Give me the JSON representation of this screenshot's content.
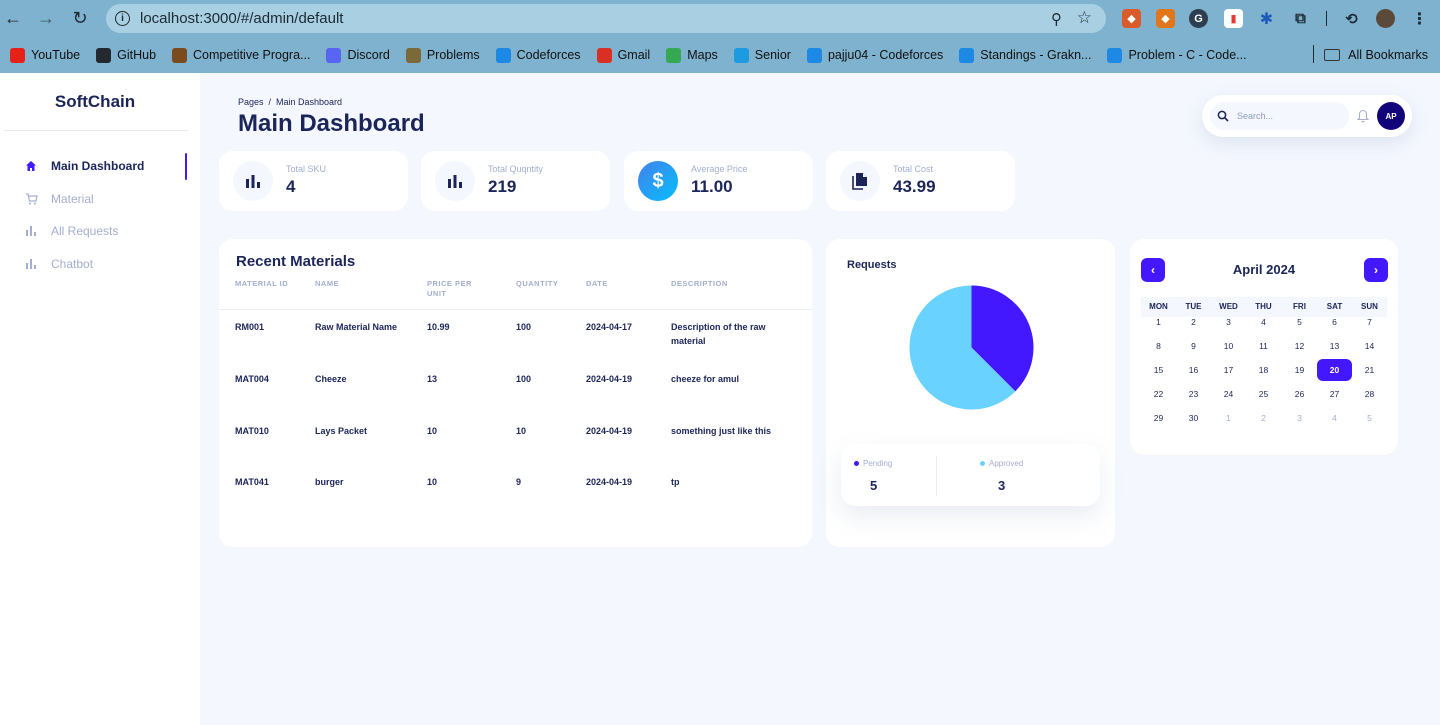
{
  "browser": {
    "url": "localhost:3000/#/admin/default",
    "bookmarks": [
      {
        "label": "YouTube",
        "color": "#e62117"
      },
      {
        "label": "GitHub",
        "color": "#24292f"
      },
      {
        "label": "Competitive Progra...",
        "color": "#7a4b21"
      },
      {
        "label": "Discord",
        "color": "#5865f2"
      },
      {
        "label": "Problems",
        "color": "#7a6a3a"
      },
      {
        "label": "Codeforces",
        "color": "#1e88e5"
      },
      {
        "label": "Gmail",
        "color": "#d93025"
      },
      {
        "label": "Maps",
        "color": "#34a853"
      },
      {
        "label": "Senior",
        "color": "#1e9be0"
      },
      {
        "label": "pajju04 - Codeforces",
        "color": "#1e88e5"
      },
      {
        "label": "Standings - Grakn...",
        "color": "#1e88e5"
      },
      {
        "label": "Problem - C - Code...",
        "color": "#1e88e5"
      }
    ],
    "all_bookmarks": "All Bookmarks"
  },
  "sidebar": {
    "brand": "SoftChain",
    "items": [
      {
        "label": "Main Dashboard",
        "icon": "home-icon"
      },
      {
        "label": "Material",
        "icon": "cart-icon"
      },
      {
        "label": "All Requests",
        "icon": "bar-chart-icon"
      },
      {
        "label": "Chatbot",
        "icon": "bar-chart-icon"
      }
    ]
  },
  "header": {
    "breadcrumb": "Pages  /  Main Dashboard",
    "title": "Main Dashboard",
    "search_placeholder": "Search...",
    "avatar_initials": "AP"
  },
  "stats": [
    {
      "label": "Total SKU",
      "value": "4",
      "icon": "bar-chart-icon"
    },
    {
      "label": "Total Quqntity",
      "value": "219",
      "icon": "bar-chart-icon"
    },
    {
      "label": "Average Price",
      "value": "11.00",
      "icon": "dollar-icon"
    },
    {
      "label": "Total Cost",
      "value": "43.99",
      "icon": "document-icon"
    }
  ],
  "materials": {
    "title": "Recent Materials",
    "columns": [
      "MATERIAL ID",
      "NAME",
      "PRICE PER UNIT",
      "QUANTITY",
      "DATE",
      "DESCRIPTION"
    ],
    "rows": [
      [
        "RM001",
        "Raw Material Name",
        "10.99",
        "100",
        "2024-04-17",
        "Description of the raw material"
      ],
      [
        "MAT004",
        "Cheeze",
        "13",
        "100",
        "2024-04-19",
        "cheeze for amul"
      ],
      [
        "MAT010",
        "Lays Packet",
        "10",
        "10",
        "2024-04-19",
        "something just like this"
      ],
      [
        "MAT041",
        "burger",
        "10",
        "9",
        "2024-04-19",
        "tp"
      ]
    ]
  },
  "requests": {
    "title": "Requests",
    "pending_label": "Pending",
    "pending_value": "5",
    "approved_label": "Approved",
    "approved_value": "3",
    "pending_color": "#6ad2ff",
    "approved_color": "#4318ff"
  },
  "chart_data": {
    "type": "pie",
    "title": "Requests",
    "categories": [
      "Pending",
      "Approved"
    ],
    "values": [
      5,
      3
    ],
    "colors": [
      "#6ad2ff",
      "#4318ff"
    ]
  },
  "calendar": {
    "title": "April 2024",
    "weekdays": [
      "MON",
      "TUE",
      "WED",
      "THU",
      "FRI",
      "SAT",
      "SUN"
    ],
    "weeks": [
      [
        "1",
        "2",
        "3",
        "4",
        "5",
        "6",
        "7"
      ],
      [
        "8",
        "9",
        "10",
        "11",
        "12",
        "13",
        "14"
      ],
      [
        "15",
        "16",
        "17",
        "18",
        "19",
        "20",
        "21"
      ],
      [
        "22",
        "23",
        "24",
        "25",
        "26",
        "27",
        "28"
      ],
      [
        "29",
        "30",
        "1",
        "2",
        "3",
        "4",
        "5"
      ]
    ],
    "selected": "20"
  }
}
